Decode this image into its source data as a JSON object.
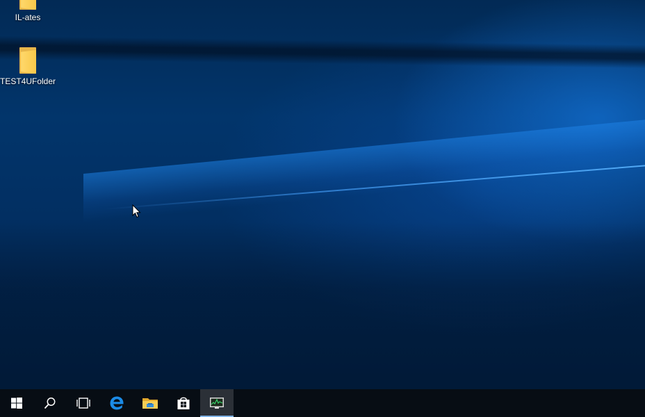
{
  "desktop": {
    "icons": [
      {
        "label": "IL-ates",
        "icon": "folder-icon"
      },
      {
        "label": "TEST4UFolder",
        "icon": "folder-icon"
      }
    ]
  },
  "taskbar": {
    "buttons": [
      {
        "name": "start",
        "icon": "windows-logo-icon"
      },
      {
        "name": "search",
        "icon": "search-icon"
      },
      {
        "name": "task-view",
        "icon": "task-view-icon"
      },
      {
        "name": "edge",
        "icon": "edge-browser-icon"
      },
      {
        "name": "file-explorer",
        "icon": "file-explorer-icon"
      },
      {
        "name": "store",
        "icon": "store-icon"
      },
      {
        "name": "resource-monitor",
        "icon": "monitor-app-icon",
        "active": true
      }
    ]
  },
  "colors": {
    "taskbar": "#070d14",
    "active_indicator": "#7fb2e6",
    "folder_yellow": "#f8c84a",
    "edge_blue": "#0a78d4"
  }
}
